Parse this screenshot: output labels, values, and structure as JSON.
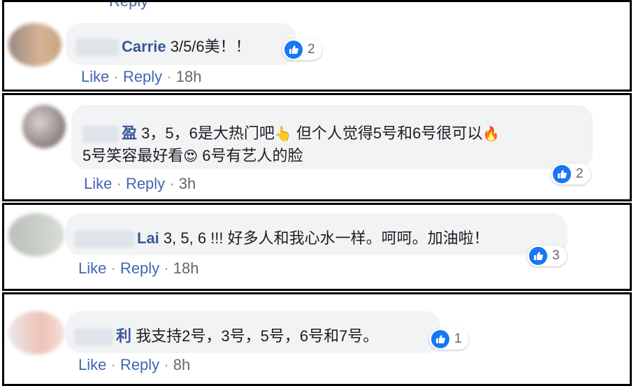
{
  "header_fragment": "Reply",
  "comments": [
    {
      "name": "Carrie",
      "lines": [
        "3/5/6美！！"
      ],
      "reactions": "2",
      "actions": {
        "like": "Like",
        "sep": "·",
        "reply": "Reply",
        "time": "18h"
      }
    },
    {
      "name": "盈",
      "lines": [
        "3，5，6是大热门吧",
        "但个人觉得5号和6号很可以",
        "5号笑容最好看",
        "6号有艺人的脸"
      ],
      "reactions": "2",
      "actions": {
        "like": "Like",
        "sep": "·",
        "reply": "Reply",
        "time": "3h"
      }
    },
    {
      "name": "Lai",
      "lines": [
        "3, 5, 6 !!! 好多人和我心水一样。呵呵。加油啦！"
      ],
      "reactions": "3",
      "actions": {
        "like": "Like",
        "sep": "·",
        "reply": "Reply",
        "time": "18h"
      }
    },
    {
      "name": "利",
      "lines": [
        "我支持2号，3号，5号，6号和7号。"
      ],
      "reactions": "1",
      "actions": {
        "like": "Like",
        "sep": "·",
        "reply": "Reply",
        "time": "8h"
      }
    }
  ],
  "icons": {
    "like": "thumbs-up-icon",
    "point": "pointing-hand-emoji",
    "fire": "fire-emoji",
    "hearts": "heart-eyes-emoji"
  },
  "colors": {
    "name": "#385898",
    "like_blue": "#1877f2",
    "link": "#4267b2",
    "bubble": "#f2f3f5"
  }
}
